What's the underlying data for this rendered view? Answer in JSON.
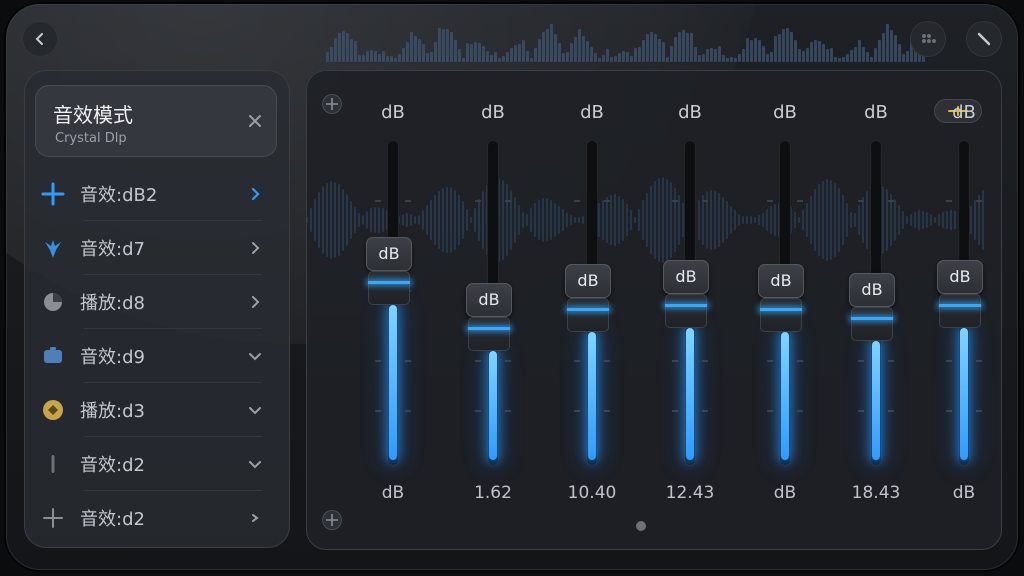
{
  "colors": {
    "accent": "#2f9bff",
    "accent_glow": "#35a8ff",
    "warning": "#e3b53a"
  },
  "nav": {
    "back_icon": "chevron-left-icon",
    "menu_icon": "dots-grid-icon",
    "edit_icon": "slash-icon"
  },
  "mode_card": {
    "title": "音效模式",
    "subtitle": "Crystal Dlp",
    "close_icon": "close-icon"
  },
  "menu": {
    "items": [
      {
        "label": "音效:dB2",
        "icon": "cross-plus-icon",
        "chevron": "right",
        "active": true
      },
      {
        "label": "音效:d7",
        "icon": "heart-icon",
        "chevron": "right",
        "active": false
      },
      {
        "label": "播放:d8",
        "icon": "pie-icon",
        "chevron": "right",
        "active": false
      },
      {
        "label": "音效:d9",
        "icon": "tv-icon",
        "chevron": "down",
        "active": false
      },
      {
        "label": "播放:d3",
        "icon": "badge-icon",
        "chevron": "down",
        "active": false
      },
      {
        "label": "音效:d2",
        "icon": "bar-icon",
        "chevron": "down",
        "active": false
      },
      {
        "label": "音效:d2",
        "icon": "crosshair-icon",
        "chevron": "right-small",
        "active": false
      }
    ]
  },
  "equalizer": {
    "corner_top_icon": "target-icon",
    "corner_bottom_icon": "target-icon",
    "preset_icon": "plus-minus-icon",
    "bands": [
      {
        "top": "dB",
        "knob": "dB",
        "bottom": "dB",
        "level": 0.56
      },
      {
        "top": "dB",
        "knob": "dB",
        "bottom": "1.62",
        "level": 0.42
      },
      {
        "top": "dB",
        "knob": "dB",
        "bottom": "10.40",
        "level": 0.48
      },
      {
        "top": "dB",
        "knob": "dB",
        "bottom": "12.43",
        "level": 0.49
      },
      {
        "top": "dB",
        "knob": "dB",
        "bottom": "dB",
        "level": 0.48
      },
      {
        "top": "dB",
        "knob": "dB",
        "bottom": "18.43",
        "level": 0.45
      },
      {
        "top": "dB",
        "knob": "dB",
        "bottom": "dB",
        "level": 0.49
      }
    ]
  }
}
